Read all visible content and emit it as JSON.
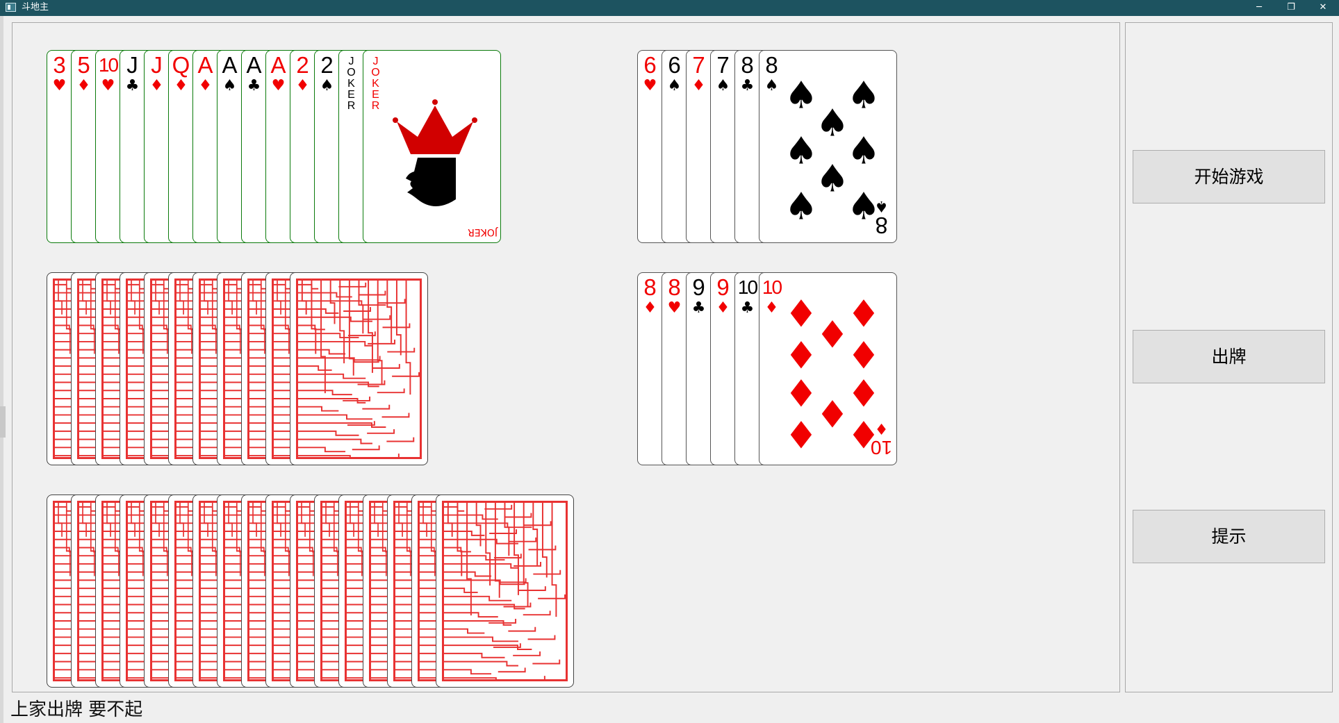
{
  "window": {
    "title": "斗地主",
    "min_label": "─",
    "max_label": "❐",
    "close_label": "✕"
  },
  "buttons": {
    "start": "开始游戏",
    "play": "出牌",
    "hint": "提示"
  },
  "status_text": "上家出牌 要不起",
  "colors": {
    "titlebar": "#1d5360",
    "card_red": "#f10000",
    "card_back_red": "#e83232"
  },
  "hands": {
    "bottom": [
      {
        "rank": "3",
        "suit": "♥",
        "color": "red"
      },
      {
        "rank": "5",
        "suit": "♦",
        "color": "red"
      },
      {
        "rank": "10",
        "suit": "♥",
        "color": "red"
      },
      {
        "rank": "J",
        "suit": "♣",
        "color": "black"
      },
      {
        "rank": "J",
        "suit": "♦",
        "color": "red"
      },
      {
        "rank": "Q",
        "suit": "♦",
        "color": "red"
      },
      {
        "rank": "A",
        "suit": "♦",
        "color": "red"
      },
      {
        "rank": "A",
        "suit": "♠",
        "color": "black"
      },
      {
        "rank": "A",
        "suit": "♣",
        "color": "black"
      },
      {
        "rank": "A",
        "suit": "♥",
        "color": "red"
      },
      {
        "rank": "2",
        "suit": "♦",
        "color": "red"
      },
      {
        "rank": "2",
        "suit": "♠",
        "color": "black"
      },
      {
        "rank": "JOKER",
        "suit": "",
        "color": "black"
      },
      {
        "rank": "JOKER",
        "suit": "",
        "color": "red"
      }
    ],
    "opponent_left_count": 11,
    "opponent_right_count": 17,
    "played_top": [
      {
        "rank": "6",
        "suit": "♥",
        "color": "red"
      },
      {
        "rank": "6",
        "suit": "♠",
        "color": "black"
      },
      {
        "rank": "7",
        "suit": "♦",
        "color": "red"
      },
      {
        "rank": "7",
        "suit": "♠",
        "color": "black"
      },
      {
        "rank": "8",
        "suit": "♣",
        "color": "black"
      },
      {
        "rank": "8",
        "suit": "♠",
        "color": "black"
      }
    ],
    "played_middle": [
      {
        "rank": "8",
        "suit": "♦",
        "color": "red"
      },
      {
        "rank": "8",
        "suit": "♥",
        "color": "red"
      },
      {
        "rank": "9",
        "suit": "♣",
        "color": "black"
      },
      {
        "rank": "9",
        "suit": "♦",
        "color": "red"
      },
      {
        "rank": "10",
        "suit": "♣",
        "color": "black"
      },
      {
        "rank": "10",
        "suit": "♦",
        "color": "red"
      }
    ]
  }
}
